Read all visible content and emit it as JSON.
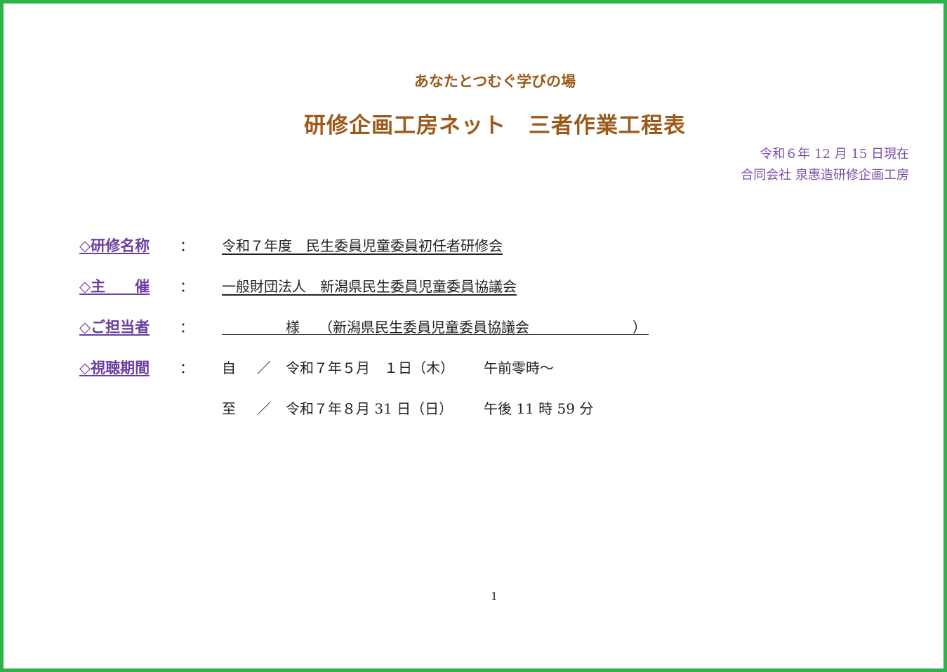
{
  "header": {
    "subtitle": "あなたとつむぐ学びの場",
    "title": "研修企画工房ネット　三者作業工程表",
    "date": "令和６年 12 月 15 日現在",
    "company": "合同会社 泉惠造研修企画工房"
  },
  "fields": {
    "course_name": {
      "label": "◇研修名称",
      "colon": "：",
      "value": "令和７年度　民生委員児童委員初任者研修会"
    },
    "organizer": {
      "label": "◇主　　催",
      "colon": "：",
      "value": "一般財団法人　新潟県民生委員児童委員協議会"
    },
    "contact": {
      "label": "◇ご担当者",
      "colon": "：",
      "sama": "様",
      "org": "（新潟県民生委員児童委員協議会",
      "close": "）"
    },
    "viewing_period": {
      "label": "◇視聴期間",
      "colon": "：",
      "from_marker": "自",
      "from_slash": "／",
      "from_date": "令和７年５月　１日（木）",
      "from_time": "午前零時～",
      "to_marker": "至",
      "to_slash": "／",
      "to_date": "令和７年８月 31 日（日）",
      "to_time": "午後 11 時 59 分"
    }
  },
  "footer": {
    "page_number": "1"
  },
  "colors": {
    "frame": "#2db34a",
    "title": "#9b5a1a",
    "label": "#6a3fa0",
    "meta": "#7b4fa8"
  }
}
